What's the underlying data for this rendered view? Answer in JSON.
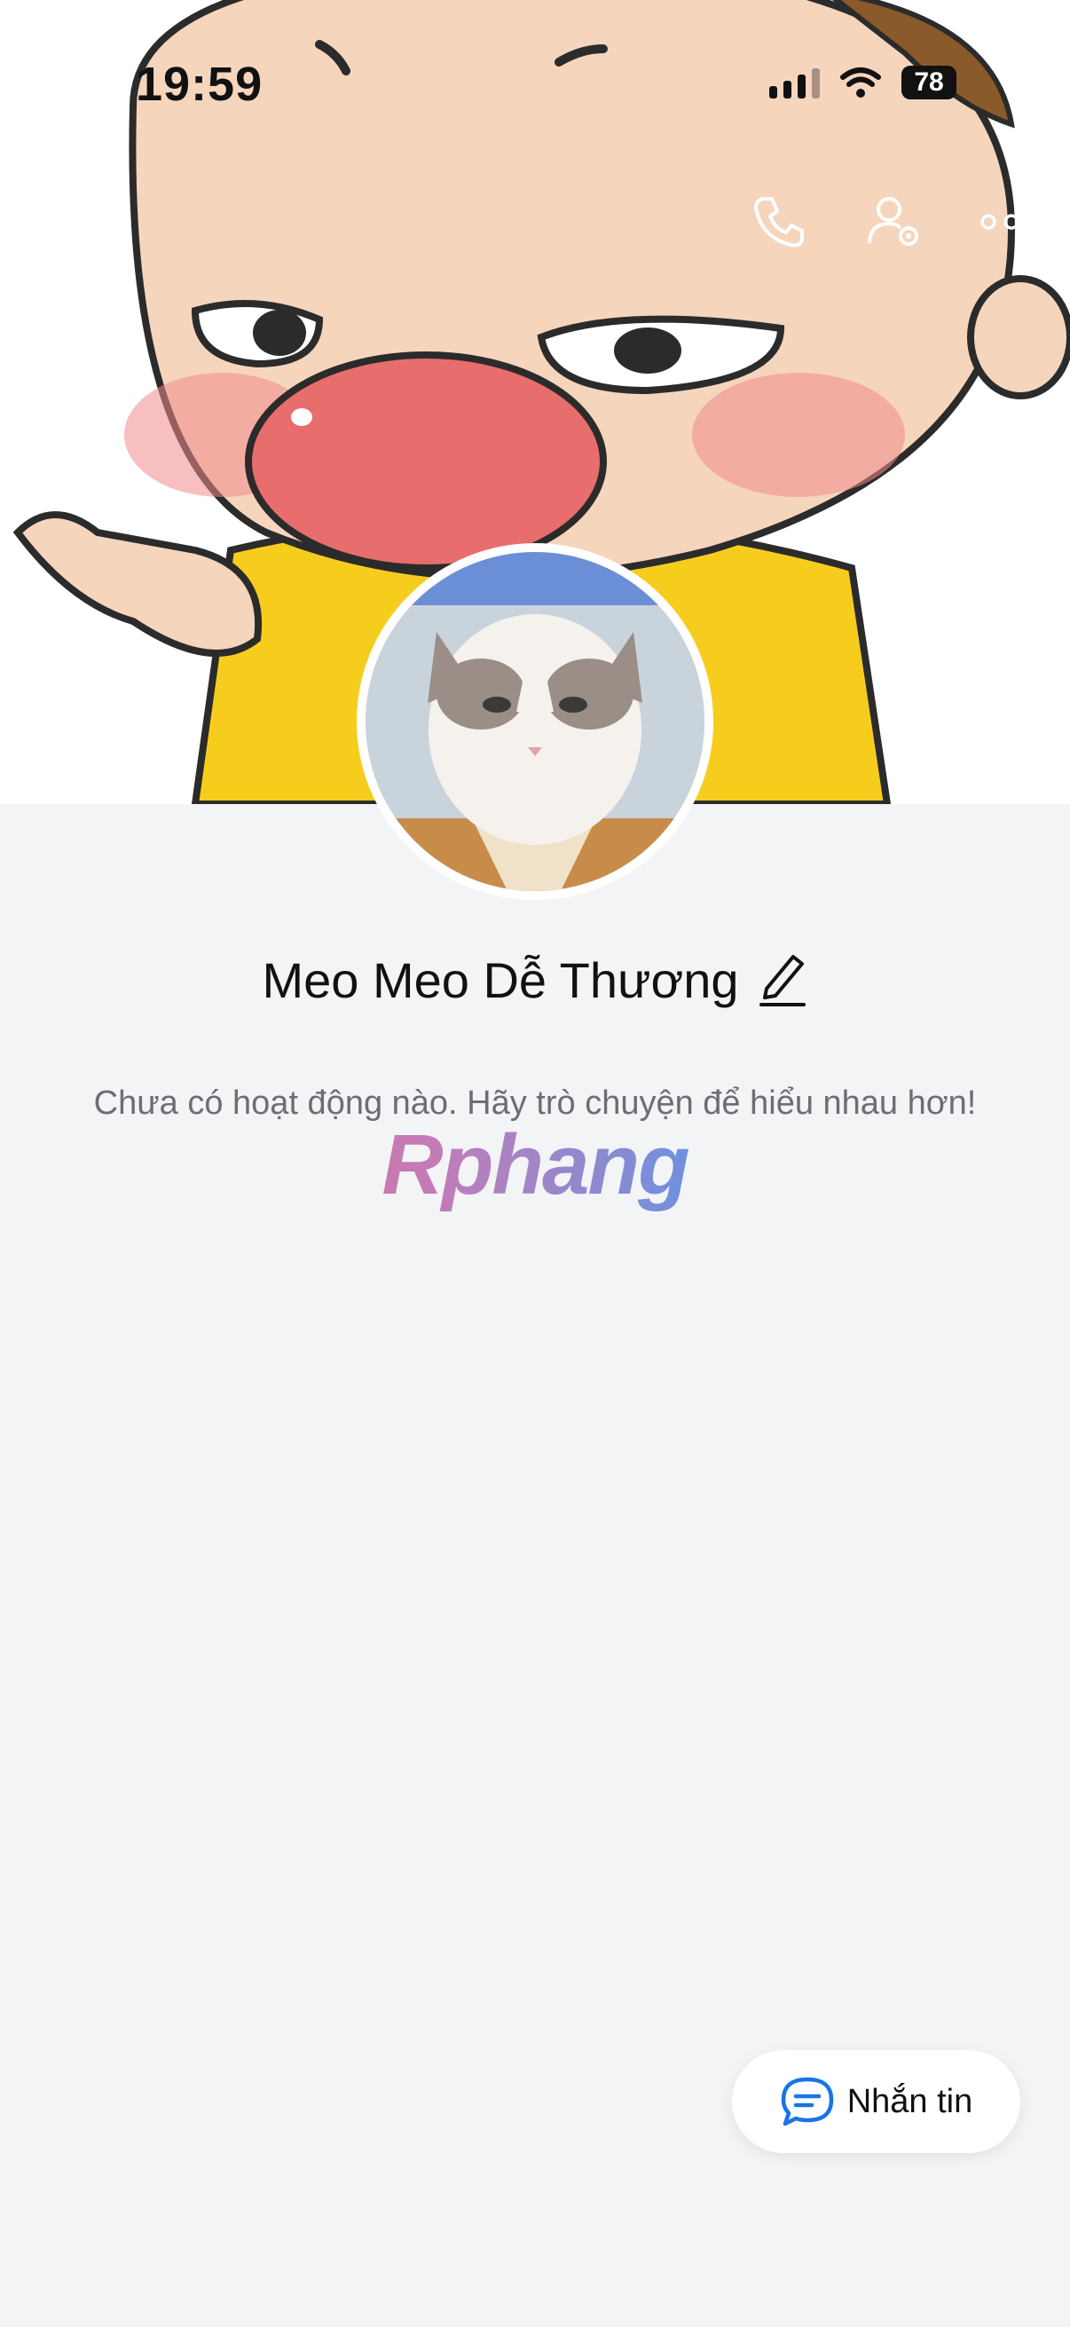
{
  "status_bar": {
    "time": "19:59",
    "battery": "78"
  },
  "header": {
    "back_icon": "chevron-left-icon",
    "call_icon": "phone-icon",
    "settings_icon": "user-settings-icon",
    "more_icon": "more-horizontal-icon"
  },
  "profile": {
    "name": "Meo Meo Dễ Thương",
    "edit_icon": "pencil-icon",
    "empty_message": "Chưa có hoạt động nào. Hãy trò chuyện để hiểu nhau hơn!"
  },
  "watermark": {
    "text": "Rphang"
  },
  "message_button": {
    "label": "Nhắn tin",
    "icon": "chat-bubble-icon",
    "accent": "#1a73e8"
  }
}
